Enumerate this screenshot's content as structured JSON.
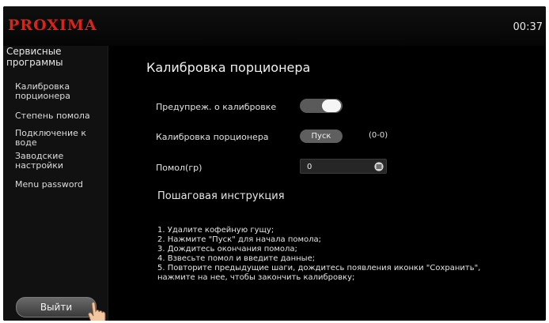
{
  "header": {
    "logo_text": "PROXIMA",
    "clock": "00:37",
    "brand_color": "#d9241c"
  },
  "sidebar": {
    "title": "Сервисные программы",
    "items": [
      {
        "label": "Калибровка порционера"
      },
      {
        "label": "Степень помола"
      },
      {
        "label": "Подключение к воде"
      },
      {
        "label": "Заводские настройки"
      },
      {
        "label": "Menu password"
      }
    ],
    "exit_label": "Выйти"
  },
  "main": {
    "title": "Калибровка порционера",
    "warning_label": "Предупреж. о калибровке",
    "warning_toggle_on": true,
    "calibration_label": "Калибровка порционера",
    "start_label": "Пуск",
    "range": "(0-0)",
    "grind_label": "Помол(гр)",
    "grind_value": "0",
    "instructions_title": "Пошаговая инструкция",
    "instructions": [
      "1. Удалите кофейную гущу;",
      "2. Нажмите \"Пуск\" для начала помола;",
      "3. Дождитесь окончания помола;",
      "4. Взвесьте помол и введите данные;",
      "5. Повторите предыдущие шаги, дождитесь появления иконки \"Сохранить\",",
      "нажмите на нее, чтобы закончить калибровку;"
    ]
  },
  "icons": {
    "keypad": "keypad-icon",
    "hand": "hand-pointer-icon"
  }
}
